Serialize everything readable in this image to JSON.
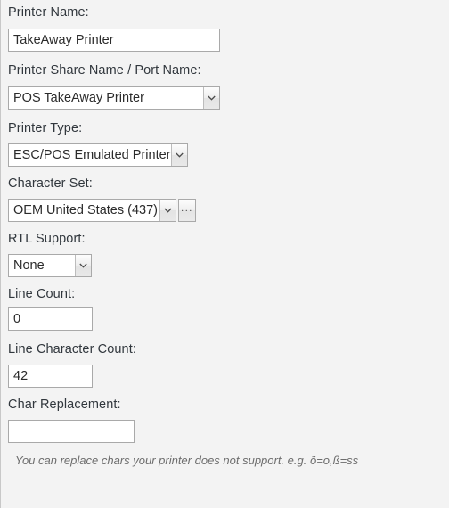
{
  "form": {
    "fields": [
      {
        "key": "printer_name",
        "label": "Printer Name:",
        "control": "text",
        "value": "TakeAway Printer",
        "placeholder": ""
      },
      {
        "key": "printer_share_name",
        "label": "Printer Share Name / Port Name:",
        "control": "combo",
        "value": "POS TakeAway Printer"
      },
      {
        "key": "printer_type",
        "label": "Printer Type:",
        "control": "combo",
        "value": "ESC/POS Emulated Printer"
      },
      {
        "key": "character_set",
        "label": "Character Set:",
        "control": "combo-ellipsis",
        "value": "OEM United States (437)",
        "browse_label": "..."
      },
      {
        "key": "rtl_support",
        "label": "RTL Support:",
        "control": "combo",
        "value": "None"
      },
      {
        "key": "line_count",
        "label": "Line Count:",
        "control": "text",
        "value": "0",
        "placeholder": ""
      },
      {
        "key": "line_character_count",
        "label": "Line Character Count:",
        "control": "text",
        "value": "42",
        "placeholder": ""
      },
      {
        "key": "char_replacement",
        "label": "Char Replacement:",
        "control": "text",
        "value": "",
        "placeholder": ""
      }
    ],
    "hint": "You can replace chars your printer does not support. e.g. ö=o,ß=ss"
  },
  "colors": {
    "background": "#f3f3f3",
    "label_text": "#31373d",
    "input_border": "#a9a9a9",
    "input_background": "#ffffff",
    "hint_text": "#6d6d6d"
  }
}
